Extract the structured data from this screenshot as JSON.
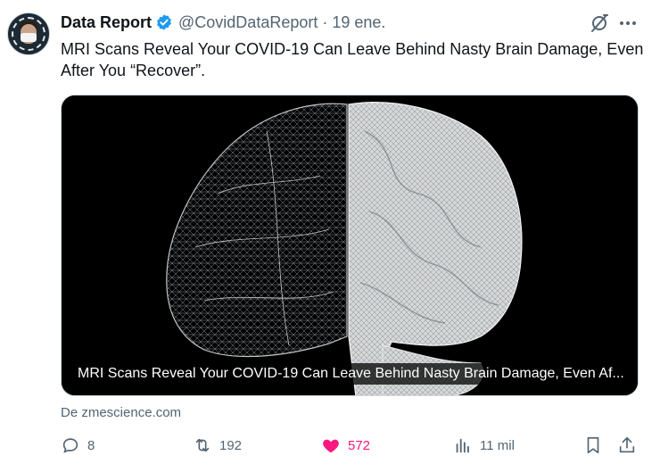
{
  "author": {
    "name": "Data Report",
    "handle": "@CovidDataReport",
    "date": "19 ene."
  },
  "tweet": {
    "text": "MRI Scans Reveal Your COVID-19 Can Leave Behind Nasty Brain Damage, Even After You “Recover”."
  },
  "media": {
    "caption": "MRI Scans Reveal Your COVID-19 Can Leave Behind Nasty Brain Damage, Even Af..."
  },
  "source": "De zmescience.com",
  "actions": {
    "replies": "8",
    "retweets": "192",
    "likes": "572",
    "views": "11 mil"
  },
  "colors": {
    "like_active": "#f91880",
    "muted_text": "#536471",
    "verified": "#1d9bf0"
  },
  "icons": {
    "verified": "verified-badge-icon",
    "grok": "grok-icon",
    "more": "more-icon",
    "reply": "reply-icon",
    "retweet": "retweet-icon",
    "like": "heart-icon",
    "views": "views-icon",
    "bookmark": "bookmark-icon",
    "share": "share-icon"
  }
}
